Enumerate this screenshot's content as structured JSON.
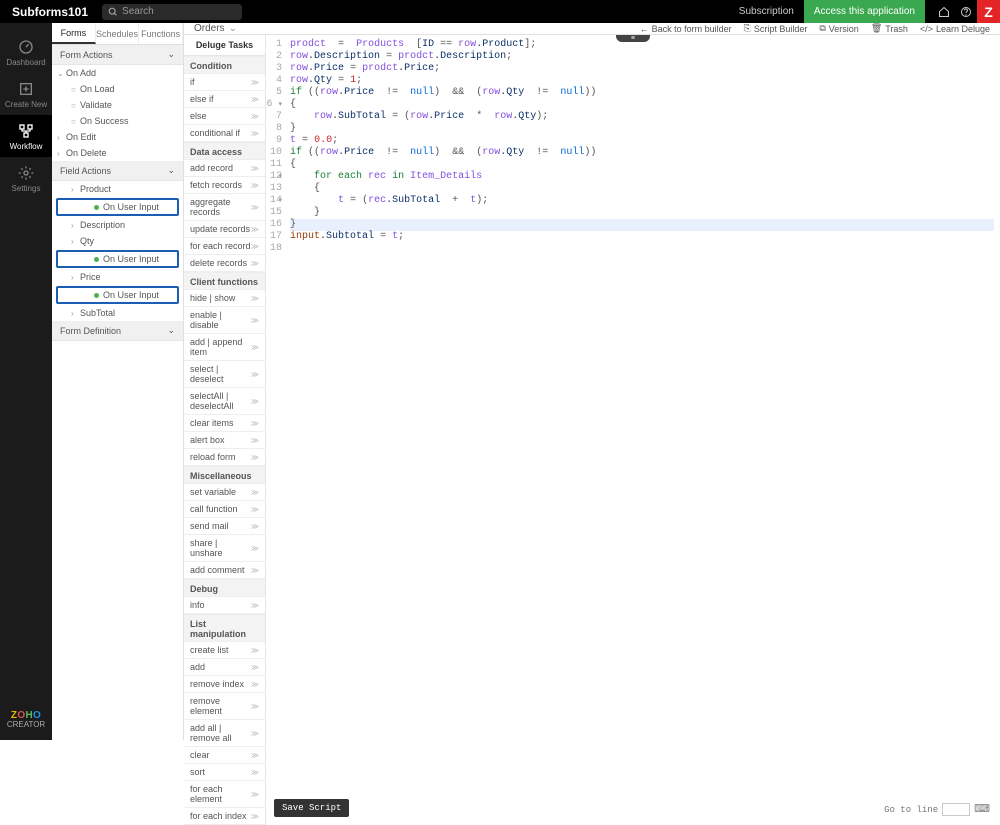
{
  "topbar": {
    "brand": "Subforms101",
    "search_placeholder": "Search",
    "subscription": "Subscription",
    "access": "Access this application"
  },
  "leftnav": {
    "items": [
      {
        "label": "Dashboard"
      },
      {
        "label": "Create New"
      },
      {
        "label": "Workflow"
      },
      {
        "label": "Settings"
      }
    ],
    "creator": "CREATOR"
  },
  "panel": {
    "tabs": [
      "Forms",
      "Schedules",
      "Functions"
    ],
    "sections": {
      "form_actions": "Form Actions",
      "field_actions": "Field Actions",
      "form_definition": "Form Definition"
    },
    "form_actions_tree": {
      "on_add": "On Add",
      "on_add_children": [
        {
          "label": "On Load"
        },
        {
          "label": "Validate"
        },
        {
          "label": "On Success"
        }
      ],
      "on_edit": "On Edit",
      "on_delete": "On Delete"
    },
    "field_actions_tree": {
      "product": "Product",
      "on_user_input": "On User Input",
      "description": "Description",
      "qty": "Qty",
      "price": "Price",
      "subtotal": "SubTotal"
    }
  },
  "center": {
    "title": "Orders",
    "back": "Back to form builder",
    "script_builder": "Script Builder",
    "version": "Version",
    "trash": "Trash",
    "learn": "Learn Deluge"
  },
  "tasks": {
    "header": "Deluge Tasks",
    "groups": [
      {
        "name": "Condition",
        "items": [
          "if",
          "else if",
          "else",
          "conditional if"
        ]
      },
      {
        "name": "Data access",
        "items": [
          "add record",
          "fetch records",
          "aggregate records",
          "update records",
          "for each record",
          "delete records"
        ]
      },
      {
        "name": "Client functions",
        "items": [
          "hide | show",
          "enable | disable",
          "add | append item",
          "select | deselect",
          "selectAll | deselectAll",
          "clear items",
          "alert box",
          "reload form"
        ]
      },
      {
        "name": "Miscellaneous",
        "items": [
          "set variable",
          "call function",
          "send mail",
          "share | unshare",
          "add comment"
        ]
      },
      {
        "name": "Debug",
        "items": [
          "info"
        ]
      },
      {
        "name": "List manipulation",
        "items": [
          "create list",
          "add",
          "remove index",
          "remove element",
          "add all | remove all",
          "clear",
          "sort",
          "for each element",
          "for each index"
        ]
      }
    ]
  },
  "code": {
    "lines": [
      {
        "n": 1,
        "html": "<span class='tk-id'>prodct</span>  <span class='tk-op'>=</span>  <span class='tk-id'>Products</span>  <span class='tk-op'>[</span><span class='tk-prop'>ID</span> <span class='tk-op'>==</span> <span class='tk-id'>row</span>.<span class='tk-prop'>Product</span><span class='tk-op'>];</span>"
      },
      {
        "n": 2,
        "html": "<span class='tk-id'>row</span>.<span class='tk-prop'>Description</span> <span class='tk-op'>=</span> <span class='tk-id'>prodct</span>.<span class='tk-prop'>Description</span><span class='tk-op'>;</span>"
      },
      {
        "n": 3,
        "html": "<span class='tk-id'>row</span>.<span class='tk-prop'>Price</span> <span class='tk-op'>=</span> <span class='tk-id'>prodct</span>.<span class='tk-prop'>Price</span><span class='tk-op'>;</span>"
      },
      {
        "n": 4,
        "html": "<span class='tk-id'>row</span>.<span class='tk-prop'>Qty</span> <span class='tk-op'>=</span> <span class='tk-num'>1</span><span class='tk-op'>;</span>"
      },
      {
        "n": 5,
        "html": "<span class='tk-kw'>if</span> <span class='tk-op'>((</span><span class='tk-id'>row</span>.<span class='tk-prop'>Price</span>  <span class='tk-op'>!=</span>  <span class='tk-null'>null</span><span class='tk-op'>)</span>  <span class='tk-op'>&amp;&amp;</span>  <span class='tk-op'>(</span><span class='tk-id'>row</span>.<span class='tk-prop'>Qty</span>  <span class='tk-op'>!=</span>  <span class='tk-null'>null</span><span class='tk-op'>))</span>"
      },
      {
        "n": 6,
        "html": "<span class='tk-op'>{</span>",
        "fold": true
      },
      {
        "n": 7,
        "html": "    <span class='tk-id'>row</span>.<span class='tk-prop'>SubTotal</span> <span class='tk-op'>=</span> <span class='tk-op'>(</span><span class='tk-id'>row</span>.<span class='tk-prop'>Price</span>  <span class='tk-op'>*</span>  <span class='tk-id'>row</span>.<span class='tk-prop'>Qty</span><span class='tk-op'>);</span>"
      },
      {
        "n": 8,
        "html": "<span class='tk-op'>}</span>"
      },
      {
        "n": 9,
        "html": "<span class='tk-id'>t</span> <span class='tk-op'>=</span> <span class='tk-num'>0.0</span><span class='tk-op'>;</span>"
      },
      {
        "n": 10,
        "html": "<span class='tk-kw'>if</span> <span class='tk-op'>((</span><span class='tk-id'>row</span>.<span class='tk-prop'>Price</span>  <span class='tk-op'>!=</span>  <span class='tk-null'>null</span><span class='tk-op'>)</span>  <span class='tk-op'>&amp;&amp;</span>  <span class='tk-op'>(</span><span class='tk-id'>row</span>.<span class='tk-prop'>Qty</span>  <span class='tk-op'>!=</span>  <span class='tk-null'>null</span><span class='tk-op'>))</span>"
      },
      {
        "n": 11,
        "html": "<span class='tk-op'>{</span>",
        "fold": true
      },
      {
        "n": 12,
        "html": "    <span class='tk-kw'>for each</span> <span class='tk-id'>rec</span> <span class='tk-kw'>in</span> <span class='tk-id'>Item_Details</span>"
      },
      {
        "n": 13,
        "html": "    <span class='tk-op'>{</span>",
        "fold": true
      },
      {
        "n": 14,
        "html": "        <span class='tk-id'>t</span> <span class='tk-op'>=</span> <span class='tk-op'>(</span><span class='tk-id'>rec</span>.<span class='tk-prop'>SubTotal</span>  <span class='tk-op'>+</span>  <span class='tk-id'>t</span><span class='tk-op'>);</span>"
      },
      {
        "n": 15,
        "html": "    <span class='tk-op'>}</span>"
      },
      {
        "n": 16,
        "html": "<span class='tk-op'>}</span>",
        "hl": true
      },
      {
        "n": 17,
        "html": "<span class='tk-fn'>input</span>.<span class='tk-prop'>Subtotal</span> <span class='tk-op'>=</span> <span class='tk-id'>t</span><span class='tk-op'>;</span>"
      },
      {
        "n": 18,
        "html": ""
      }
    ]
  },
  "footer": {
    "save": "Save Script",
    "goto": "Go to line"
  }
}
